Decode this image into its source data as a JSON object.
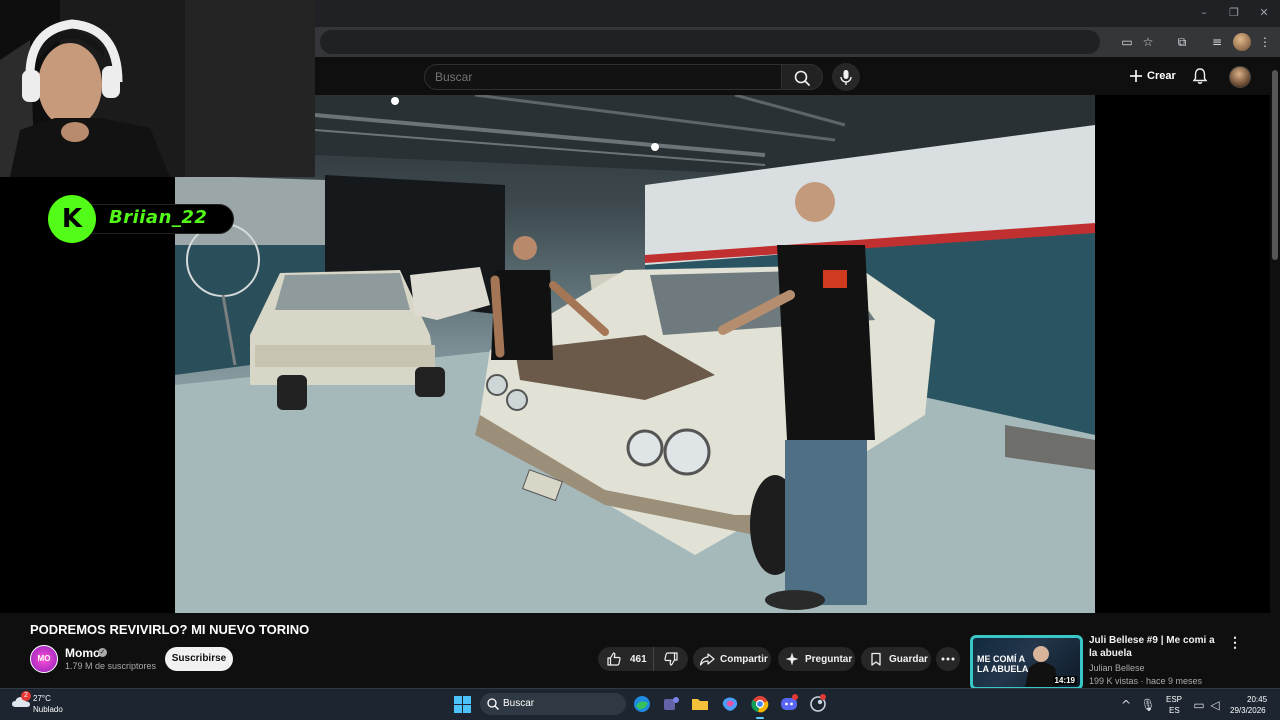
{
  "youtube": {
    "search_placeholder": "Buscar",
    "create_label": "Crear"
  },
  "overlay": {
    "streamer_name": "Briian_22",
    "platform_icon": "K"
  },
  "video": {
    "title": "PODREMOS REVIVIRLO? MI NUEVO TORINO",
    "channel_name": "Momo",
    "channel_avatar_text": "MO",
    "subscribers": "1.79 M de suscriptores",
    "subscribe_label": "Suscribirse",
    "likes": "461",
    "share_label": "Compartir",
    "ask_label": "Preguntar",
    "save_label": "Guardar"
  },
  "recommendation": {
    "title": "Juli Bellese #9 | Me comi a la abuela",
    "channel": "Julian Bellese",
    "meta": "199 K vistas · hace 9 meses",
    "duration": "14:19",
    "thumb_text": "ME COMÍ A LA ABUELA"
  },
  "taskbar": {
    "temperature": "27°C",
    "weather": "Nublado",
    "weather_badge": "2",
    "search_label": "Buscar",
    "lang_primary": "ESP",
    "lang_secondary": "ES",
    "time": "20:45",
    "date": "29/3/2026"
  },
  "colors": {
    "kick_green": "#53fc18",
    "rec_border": "#39c6c6",
    "taskbar_accent": "#60cdff"
  }
}
